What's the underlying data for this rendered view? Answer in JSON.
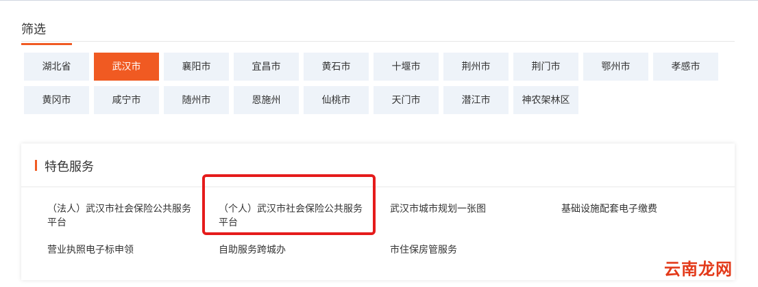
{
  "filter": {
    "title": "筛选"
  },
  "cities": [
    {
      "label": "湖北省",
      "active": false
    },
    {
      "label": "武汉市",
      "active": true
    },
    {
      "label": "襄阳市",
      "active": false
    },
    {
      "label": "宜昌市",
      "active": false
    },
    {
      "label": "黄石市",
      "active": false
    },
    {
      "label": "十堰市",
      "active": false
    },
    {
      "label": "荆州市",
      "active": false
    },
    {
      "label": "荆门市",
      "active": false
    },
    {
      "label": "鄂州市",
      "active": false
    },
    {
      "label": "孝感市",
      "active": false
    },
    {
      "label": "黄冈市",
      "active": false
    },
    {
      "label": "咸宁市",
      "active": false
    },
    {
      "label": "随州市",
      "active": false
    },
    {
      "label": "恩施州",
      "active": false
    },
    {
      "label": "仙桃市",
      "active": false
    },
    {
      "label": "天门市",
      "active": false
    },
    {
      "label": "潜江市",
      "active": false
    },
    {
      "label": "神农架林区",
      "active": false
    }
  ],
  "services": {
    "title": "特色服务",
    "items": [
      {
        "label": "（法人）武汉市社会保险公共服务平台"
      },
      {
        "label": "（个人）武汉市社会保险公共服务平台"
      },
      {
        "label": "武汉市城市规划一张图"
      },
      {
        "label": "基础设施配套电子缴费"
      },
      {
        "label": "营业执照电子标申领"
      },
      {
        "label": "自助服务跨城办"
      },
      {
        "label": "市住保房管服务"
      }
    ]
  },
  "watermark": "云南龙网",
  "colors": {
    "accent": "#f05a22",
    "highlight": "#e51b1b",
    "chip_bg": "#eef3f9"
  }
}
